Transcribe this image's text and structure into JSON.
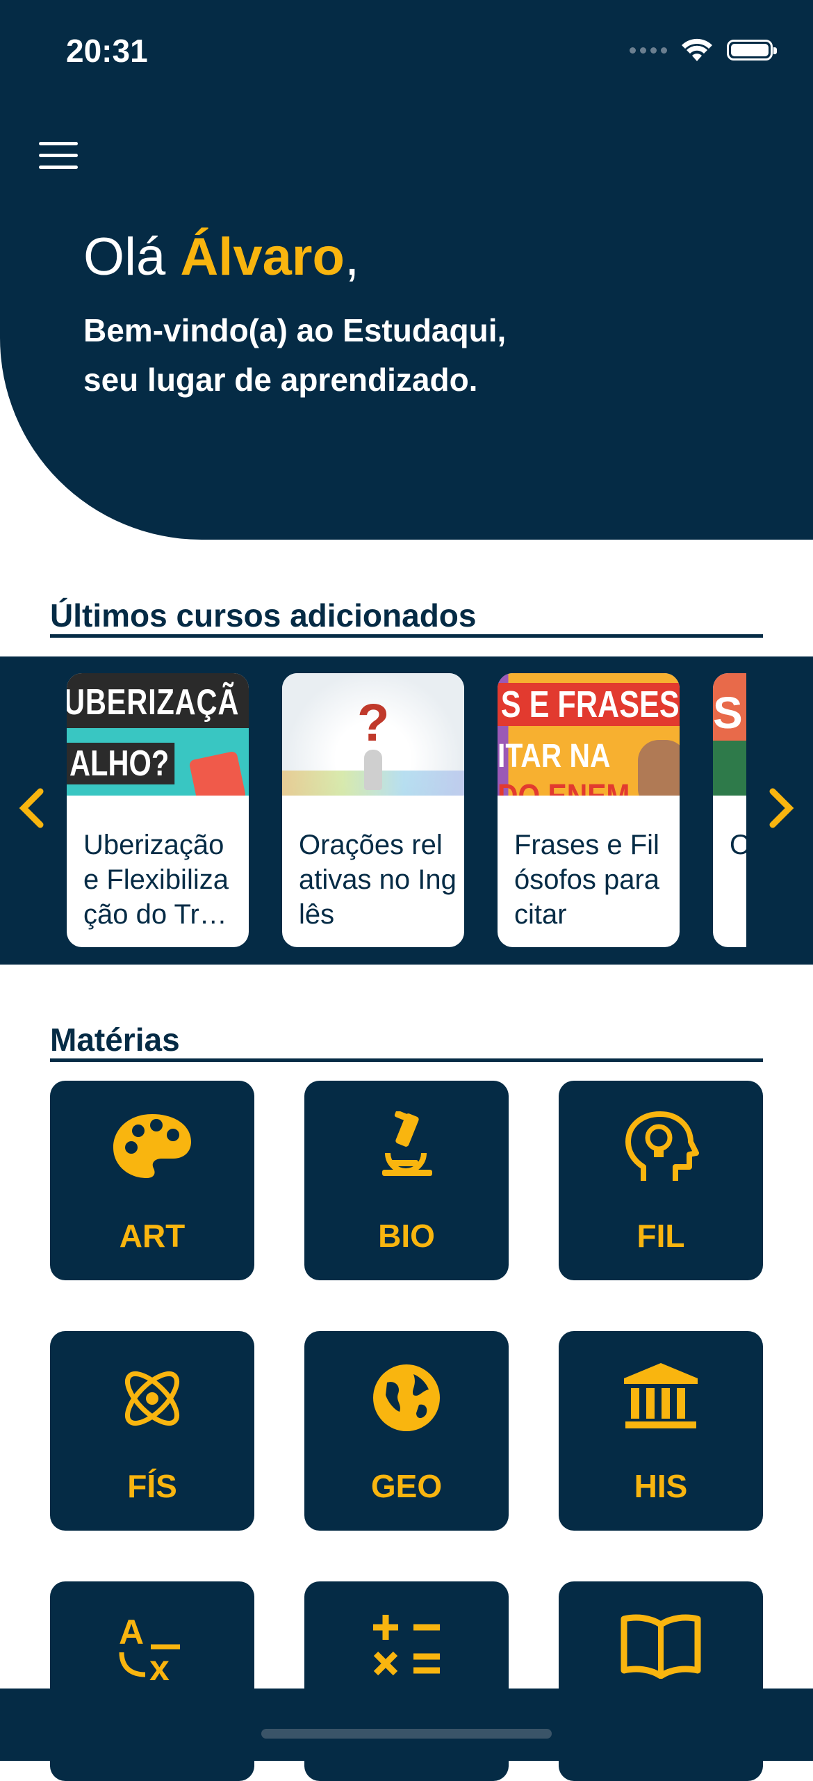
{
  "status_bar": {
    "time": "20:31"
  },
  "header": {
    "greeting_prefix": "Olá ",
    "user_name": "Álvaro",
    "greeting_suffix": ",",
    "welcome_line1": "Bem-vindo(a) ao Estudaqui,",
    "welcome_line2": "seu lugar de aprendizado."
  },
  "latest_courses": {
    "title": "Últimos cursos adicionados",
    "cards": [
      {
        "title": "Uberização e Flexibilização do Trabalho",
        "thumb_line1": "UBERIZAÇÃ",
        "thumb_line2": "ALHO?"
      },
      {
        "title": "Orações relativas no Inglês"
      },
      {
        "title": "Frases e Filósofos para citar",
        "thumb_line1": "S E FRASES",
        "thumb_line2": "ITAR NA",
        "thumb_line3": "DO ENEM"
      },
      {
        "title": "O s m",
        "thumb_line1": "S"
      }
    ]
  },
  "subjects": {
    "title": "Matérias",
    "items": [
      {
        "label": "ART",
        "icon": "palette-icon"
      },
      {
        "label": "BIO",
        "icon": "microscope-icon"
      },
      {
        "label": "FIL",
        "icon": "head-lightbulb-icon"
      },
      {
        "label": "FÍS",
        "icon": "atom-icon"
      },
      {
        "label": "GEO",
        "icon": "globe-icon"
      },
      {
        "label": "HIS",
        "icon": "landmark-icon"
      },
      {
        "label": "",
        "icon": "translate-icon"
      },
      {
        "label": "",
        "icon": "math-operators-icon"
      },
      {
        "label": "",
        "icon": "open-book-icon"
      }
    ]
  },
  "colors": {
    "primary": "#052b45",
    "accent": "#f9b50f",
    "background": "#ffffff"
  }
}
